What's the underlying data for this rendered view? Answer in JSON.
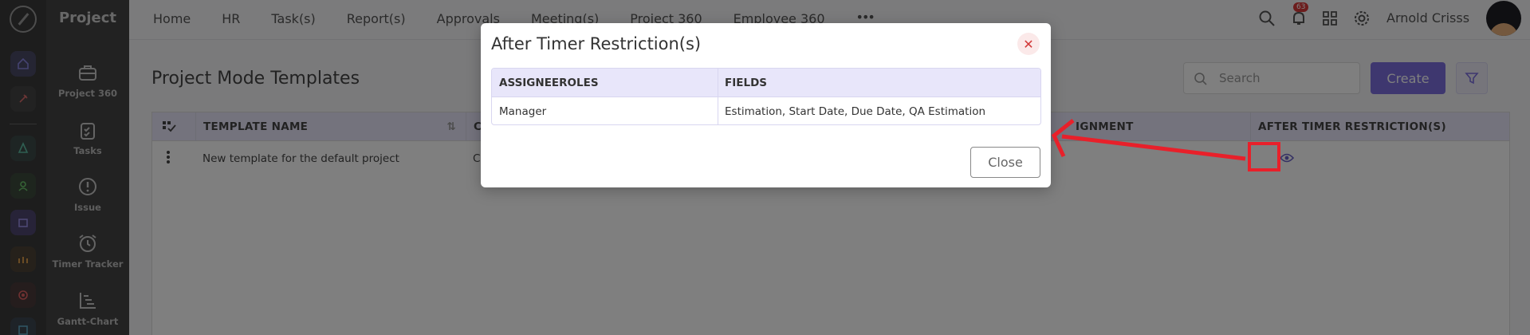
{
  "app": {
    "section_title": "Project"
  },
  "rail": {
    "icons": [
      "home-icon",
      "pin-icon",
      "tree-icon",
      "people-icon",
      "box-icon",
      "team-icon",
      "target-icon",
      "calendar-icon"
    ]
  },
  "nav2": {
    "items": [
      {
        "label": "Project 360",
        "icon": "briefcase-icon"
      },
      {
        "label": "Tasks",
        "icon": "clipboard-icon"
      },
      {
        "label": "Issue",
        "icon": "alert-icon"
      },
      {
        "label": "Timer Tracker",
        "icon": "alarm-icon"
      },
      {
        "label": "Gantt-Chart",
        "icon": "chart-icon"
      }
    ]
  },
  "topnav": {
    "items": [
      "Home",
      "HR",
      "Task(s)",
      "Report(s)",
      "Approvals",
      "Meeting(s)",
      "Project 360",
      "Employee 360"
    ]
  },
  "user": {
    "name": "Arnold Crisss",
    "notification_count": "63"
  },
  "page": {
    "title": "Project Mode Templates",
    "search_placeholder": "Search",
    "create_label": "Create"
  },
  "table": {
    "columns": [
      "TEMPLATE NAME",
      "C",
      "IGNMENT",
      "AFTER TIMER RESTRICTION(S)"
    ],
    "rows": [
      {
        "template_name": "New template for the default project",
        "c": "C"
      }
    ]
  },
  "modal": {
    "title": "After Timer Restriction(s)",
    "columns": [
      "ASSIGNEEROLES",
      "FIELDS"
    ],
    "rows": [
      {
        "role": "Manager",
        "fields": "Estimation, Start Date, Due Date, QA Estimation"
      }
    ],
    "close_label": "Close"
  },
  "colors": {
    "accent": "#7c6fde",
    "header_bg": "#e8e6fa",
    "annotation": "#e8202a",
    "sidebar": "#3a3a3a"
  }
}
